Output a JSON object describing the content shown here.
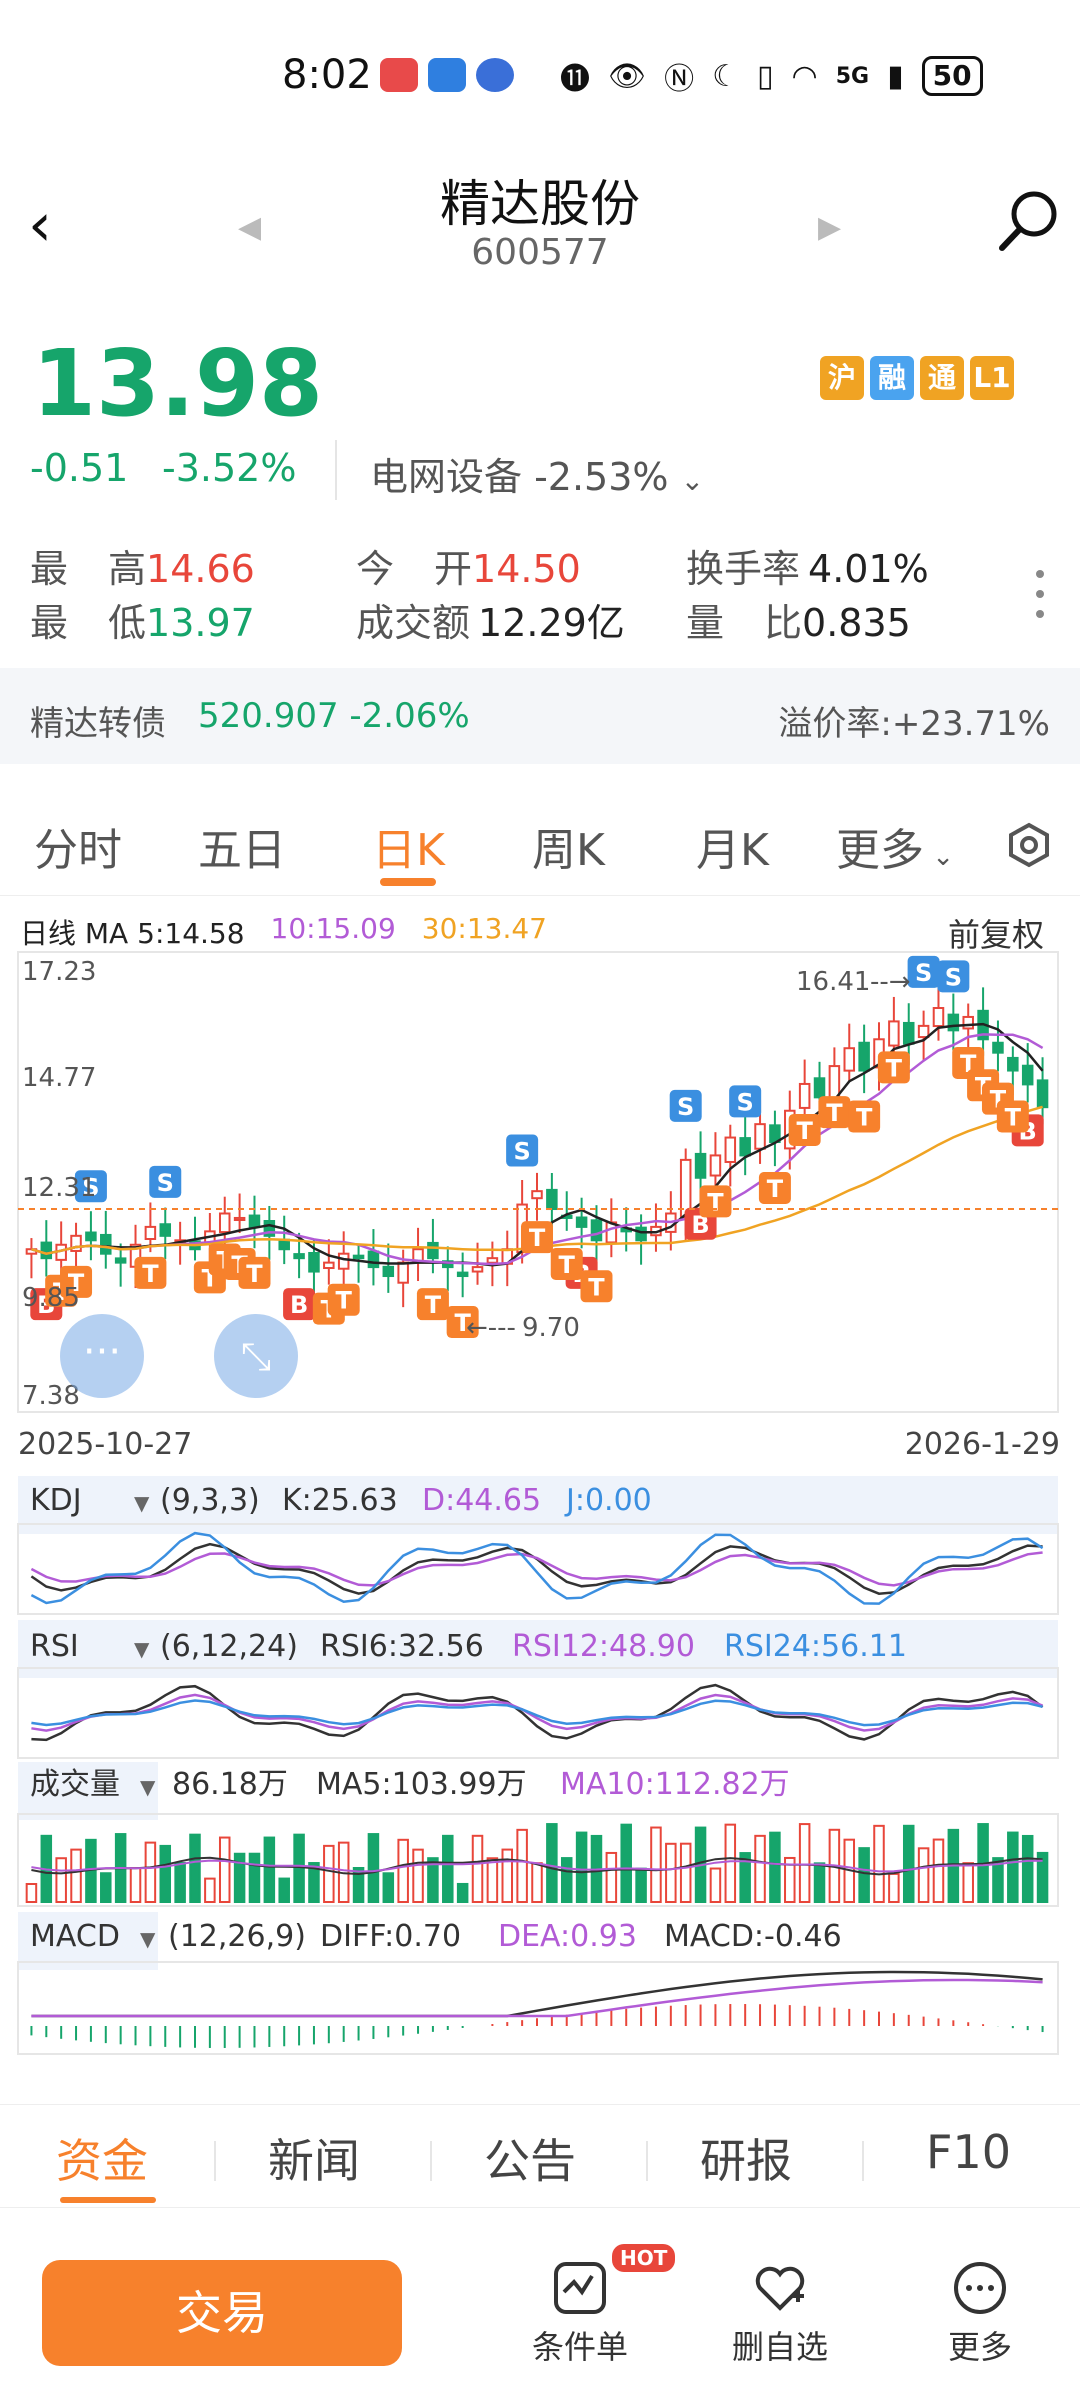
{
  "status_bar": {
    "time": "8:02",
    "network": "5G",
    "battery": "50"
  },
  "header": {
    "stock_name": "精达股份",
    "stock_code": "600577"
  },
  "quote": {
    "price": "13.98",
    "change": "-0.51",
    "change_pct": "-3.52%",
    "sector": "电网设备 -2.53%",
    "badges": [
      "沪",
      "融",
      "通",
      "L1"
    ]
  },
  "stats": {
    "high_label_a": "最",
    "high_label_b": "高",
    "high": "14.66",
    "low_label_a": "最",
    "low_label_b": "低",
    "low": "13.97",
    "open_label_a": "今",
    "open_label_b": "开",
    "open": "14.50",
    "amount_label": "成交额",
    "amount": "12.29亿",
    "turnover_label": "换手率",
    "turnover": "4.01%",
    "vol_ratio_label_a": "量",
    "vol_ratio_label_b": "比",
    "vol_ratio": "0.835"
  },
  "bond": {
    "name": "精达转债",
    "value": "520.907  -2.06%",
    "premium": "溢价率:+23.71%"
  },
  "chart_tabs": [
    "分时",
    "五日",
    "日K",
    "周K",
    "月K",
    "更多"
  ],
  "chart_legend": {
    "prefix": "日线 MA",
    "ma5": "5:14.58",
    "ma10": "10:15.09",
    "ma30": "30:13.47",
    "adjust": "前复权"
  },
  "colors": {
    "up": "#e8463a",
    "down": "#16a56b",
    "accent": "#f7812c",
    "ma10": "#b25bd6",
    "ma30": "#f0a323",
    "blue": "#3b8fe0"
  },
  "chart_data": [
    {
      "type": "candlestick",
      "title": "日线",
      "y_ticks": [
        "17.23",
        "14.77",
        "12.31",
        "9.85",
        "7.38"
      ],
      "ylim": [
        7.38,
        17.23
      ],
      "x_start": "2025-10-27",
      "x_end": "2026-1-29",
      "high_marker": "16.41",
      "low_marker": "9.70",
      "series": [
        {
          "name": "MA5",
          "last": 14.58
        },
        {
          "name": "MA10",
          "last": 15.09
        },
        {
          "name": "MA30",
          "last": 13.47
        }
      ],
      "closes": [
        10.8,
        10.6,
        10.9,
        11.1,
        11.0,
        10.7,
        10.5,
        10.9,
        11.3,
        11.1,
        11.0,
        10.8,
        11.2,
        11.6,
        11.5,
        11.3,
        11.1,
        10.8,
        10.6,
        10.3,
        10.5,
        10.7,
        10.6,
        10.4,
        10.2,
        10.5,
        10.8,
        10.6,
        10.4,
        10.2,
        10.4,
        10.6,
        10.8,
        11.8,
        12.1,
        11.7,
        11.5,
        11.3,
        11.0,
        11.4,
        11.2,
        11.0,
        11.3,
        11.6,
        12.8,
        12.4,
        12.9,
        13.3,
        12.9,
        13.6,
        13.2,
        13.9,
        14.5,
        14.2,
        14.9,
        15.3,
        14.8,
        15.5,
        15.9,
        15.4,
        15.8,
        16.2,
        15.7,
        16.0,
        15.5,
        15.2,
        14.8,
        14.49,
        13.98
      ],
      "markers": [
        "S",
        "B",
        "T"
      ]
    },
    {
      "type": "line",
      "title": "KDJ",
      "params": "(9,3,3)",
      "series": [
        {
          "name": "K",
          "value": "K:25.63"
        },
        {
          "name": "D",
          "value": "D:44.65"
        },
        {
          "name": "J",
          "value": "J:0.00"
        }
      ]
    },
    {
      "type": "line",
      "title": "RSI",
      "params": "(6,12,24)",
      "series": [
        {
          "name": "RSI6",
          "value": "RSI6:32.56"
        },
        {
          "name": "RSI12",
          "value": "RSI12:48.90"
        },
        {
          "name": "RSI24",
          "value": "RSI24:56.11"
        }
      ]
    },
    {
      "type": "bar",
      "title": "成交量",
      "series": [
        {
          "name": "VOL",
          "value": "86.18万"
        },
        {
          "name": "MA5",
          "value": "MA5:103.99万"
        },
        {
          "name": "MA10",
          "value": "MA10:112.82万"
        }
      ]
    },
    {
      "type": "bar",
      "title": "MACD",
      "params": "(12,26,9)",
      "series": [
        {
          "name": "DIFF",
          "value": "DIFF:0.70"
        },
        {
          "name": "DEA",
          "value": "DEA:0.93"
        },
        {
          "name": "MACD",
          "value": "MACD:-0.46"
        }
      ]
    }
  ],
  "bottom_tabs": [
    "资金",
    "新闻",
    "公告",
    "研报",
    "F10"
  ],
  "footer": {
    "trade_label": "交易",
    "condition_label": "条件单",
    "hot_badge": "HOT",
    "remove_watch_label": "删自选",
    "more_label": "更多"
  }
}
